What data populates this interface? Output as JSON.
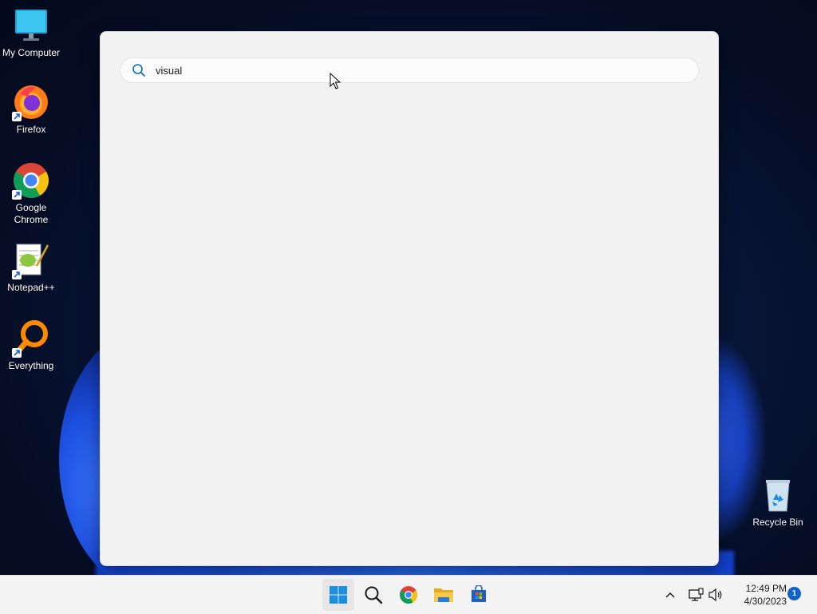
{
  "desktop": {
    "icons": [
      {
        "label": "My Computer"
      },
      {
        "label": "Firefox"
      },
      {
        "label": "Google Chrome"
      },
      {
        "label": "Notepad++"
      },
      {
        "label": "Everything"
      },
      {
        "label": "Recycle Bin"
      }
    ]
  },
  "search": {
    "query": "visual",
    "icon": "search-icon"
  },
  "taskbar": {
    "items": [
      "start-icon",
      "search-icon",
      "chrome-icon",
      "file-explorer-icon",
      "store-icon"
    ],
    "tray": {
      "time": "12:49 PM",
      "date": "4/30/2023",
      "notification_count": "1"
    }
  },
  "colors": {
    "accent": "#0f63c8",
    "wallpaper": "#08163a",
    "panel": "#f2f2f2"
  }
}
